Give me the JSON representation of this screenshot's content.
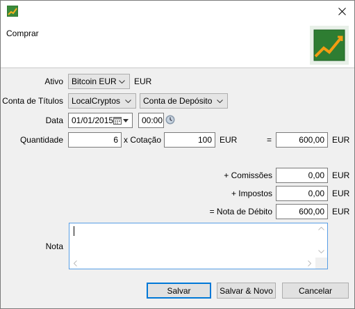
{
  "window": {
    "close_label": "✕"
  },
  "dialog": {
    "title": "Comprar"
  },
  "form": {
    "ativo": {
      "label": "Ativo",
      "value": "Bitcoin EUR",
      "currency": "EUR"
    },
    "conta_titulos": {
      "label": "Conta de Títulos",
      "value": "LocalCryptos",
      "deposit_value": "Conta de Depósito"
    },
    "data": {
      "label": "Data",
      "date": "01/01/2015",
      "time": "00:00"
    },
    "quantidade": {
      "label": "Quantidade",
      "value": "6"
    },
    "cotacao": {
      "label": "x Cotação",
      "value": "100",
      "currency": "EUR"
    },
    "total": {
      "label": "=",
      "value": "600,00",
      "currency": "EUR"
    },
    "comissoes": {
      "label": "+ Comissões",
      "value": "0,00",
      "currency": "EUR"
    },
    "impostos": {
      "label": "+ Impostos",
      "value": "0,00",
      "currency": "EUR"
    },
    "nota_debito": {
      "label": "= Nota de Débito",
      "value": "600,00",
      "currency": "EUR"
    },
    "nota": {
      "label": "Nota",
      "value": ""
    }
  },
  "buttons": {
    "save": "Salvar",
    "save_new": "Salvar & Novo",
    "cancel": "Cancelar"
  },
  "colors": {
    "accent": "#0078d7",
    "focus": "#569de5",
    "logo_bg": "#2e7d32",
    "logo_line": "#f39c12"
  }
}
